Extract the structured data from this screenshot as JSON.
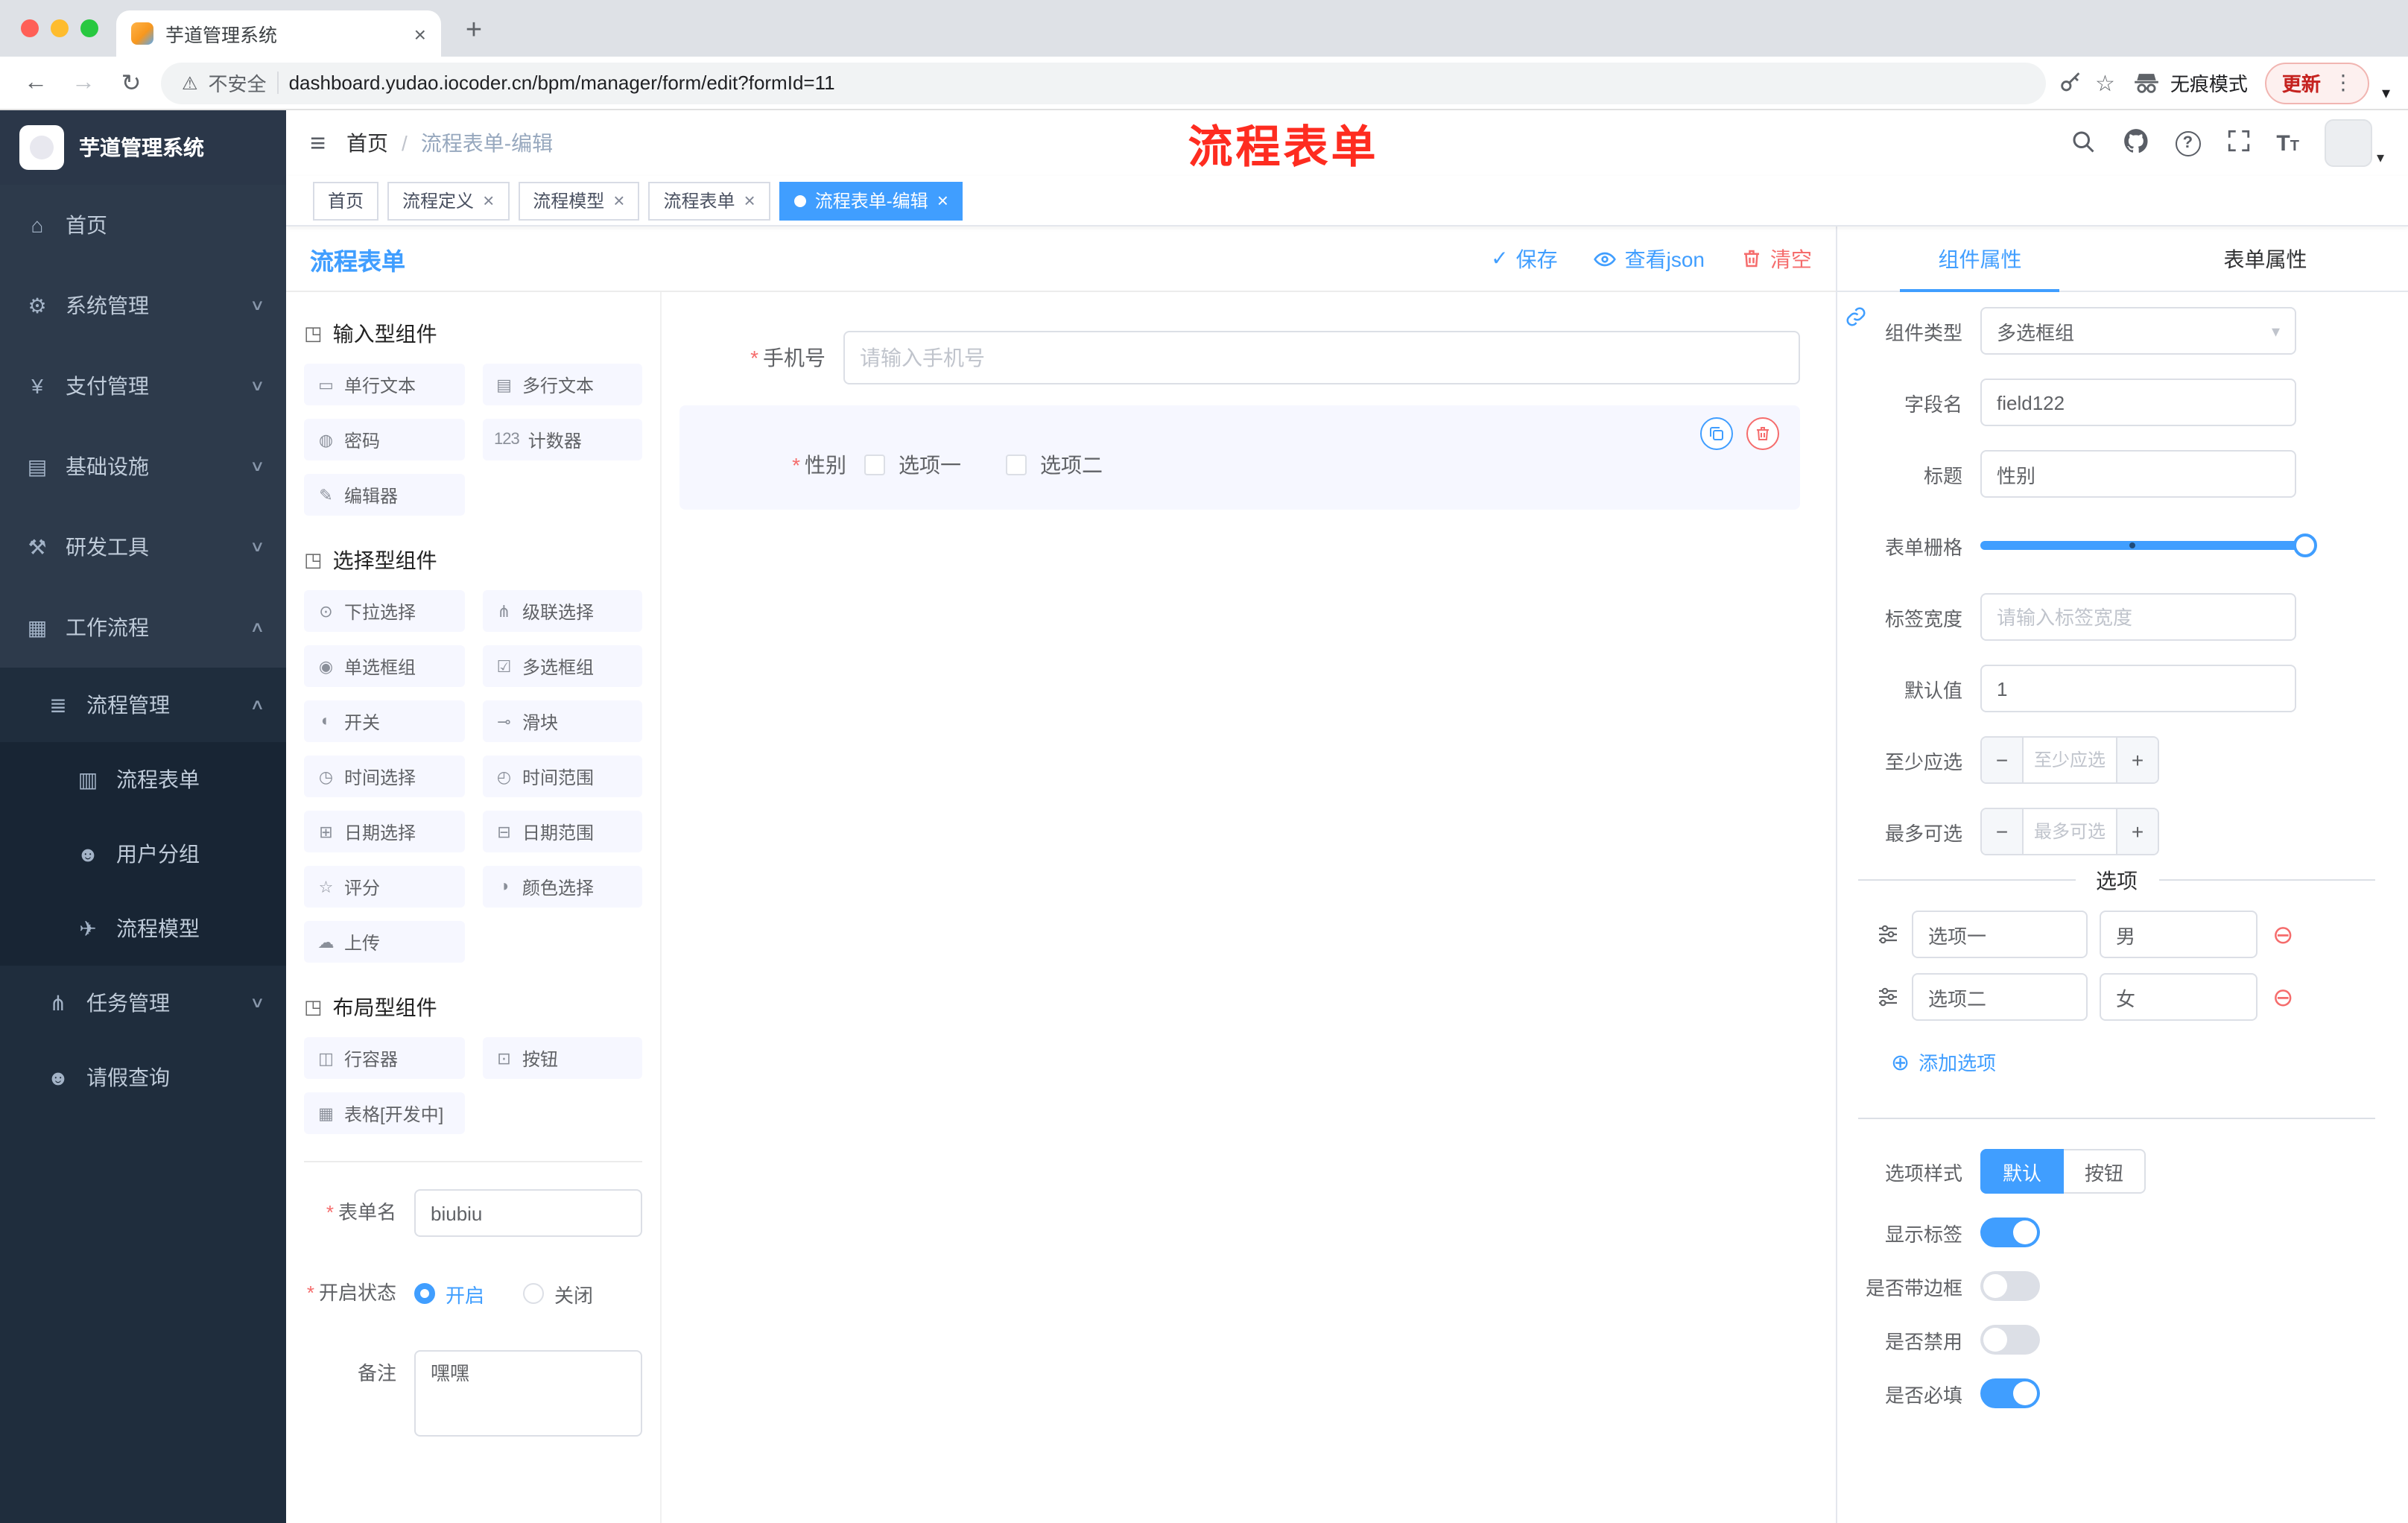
{
  "colors": {
    "primary": "#409eff",
    "danger": "#f56c6c",
    "sidebar_bg": "#2d3a4b",
    "annotation_red": "#fe2c20",
    "tag_active": "#409eff"
  },
  "icons": {
    "back": "←",
    "forward": "→",
    "reload": "↻",
    "warning": "⚠",
    "star": "☆",
    "kebab": "⋮",
    "caret_down": "▾",
    "plus": "+",
    "close": "×",
    "hamburger": "≡",
    "check": "✓",
    "circle_plus": "⊕",
    "circle_minus": "⊖",
    "minus": "−",
    "chevron_down": "∨",
    "chevron_up": "∧",
    "select_caret": "▾",
    "required": "*"
  },
  "browser": {
    "tab_title": "芋道管理系统",
    "security_label": "不安全",
    "url": "dashboard.yudao.iocoder.cn/bpm/manager/form/edit?formId=11",
    "incognito_label": "无痕模式",
    "update_label": "更新"
  },
  "sidebar": {
    "app_title": "芋道管理系统",
    "items": [
      {
        "icon": "⌂",
        "label": "首页"
      },
      {
        "icon": "⚙",
        "label": "系统管理"
      },
      {
        "icon": "¥",
        "label": "支付管理"
      },
      {
        "icon": "▤",
        "label": "基础设施"
      },
      {
        "icon": "⚒",
        "label": "研发工具"
      },
      {
        "icon": "▦",
        "label": "工作流程"
      },
      {
        "icon": "≣",
        "label": "流程管理"
      },
      {
        "icon": "▥",
        "label": "流程表单"
      },
      {
        "icon": "☻",
        "label": "用户分组"
      },
      {
        "icon": "✈",
        "label": "流程模型"
      },
      {
        "icon": "⋔",
        "label": "任务管理"
      },
      {
        "icon": "☻",
        "label": "请假查询"
      }
    ]
  },
  "navbar": {
    "breadcrumb_home": "首页",
    "breadcrumb_sep": "/",
    "breadcrumb_current": "流程表单-编辑",
    "annotation": "流程表单"
  },
  "tags": [
    {
      "label": "首页"
    },
    {
      "label": "流程定义",
      "close": "×"
    },
    {
      "label": "流程模型",
      "close": "×"
    },
    {
      "label": "流程表单",
      "close": "×"
    },
    {
      "label": "流程表单-编辑",
      "close": "×"
    }
  ],
  "designer": {
    "title": "流程表单",
    "save": "保存",
    "view_json": "查看json",
    "clear": "清空"
  },
  "palette": {
    "sections": [
      {
        "icon": "◳",
        "title": "输入型组件",
        "items": [
          {
            "icon": "▭",
            "label": "单行文本"
          },
          {
            "icon": "▤",
            "label": "多行文本"
          },
          {
            "icon": "◍",
            "label": "密码"
          },
          {
            "icon": "123",
            "label": "计数器"
          },
          {
            "icon": "✎",
            "label": "编辑器"
          }
        ]
      },
      {
        "icon": "◳",
        "title": "选择型组件",
        "items": [
          {
            "icon": "⊙",
            "label": "下拉选择"
          },
          {
            "icon": "⋔",
            "label": "级联选择"
          },
          {
            "icon": "◉",
            "label": "单选框组"
          },
          {
            "icon": "☑",
            "label": "多选框组"
          },
          {
            "icon": "◐",
            "label": "开关"
          },
          {
            "icon": "⊸",
            "label": "滑块"
          },
          {
            "icon": "◷",
            "label": "时间选择"
          },
          {
            "icon": "◴",
            "label": "时间范围"
          },
          {
            "icon": "⊞",
            "label": "日期选择"
          },
          {
            "icon": "⊟",
            "label": "日期范围"
          },
          {
            "icon": "☆",
            "label": "评分"
          },
          {
            "icon": "◑",
            "label": "颜色选择"
          },
          {
            "icon": "☁",
            "label": "上传"
          }
        ]
      },
      {
        "icon": "◳",
        "title": "布局型组件",
        "items": [
          {
            "icon": "◫",
            "label": "行容器"
          },
          {
            "icon": "⊡",
            "label": "按钮"
          },
          {
            "icon": "▦",
            "label": "表格[开发中]"
          }
        ]
      }
    ],
    "form": {
      "name_label": "表单名",
      "name_value": "biubiu",
      "status_label": "开启状态",
      "status_on": "开启",
      "status_off": "关闭",
      "remark_label": "备注",
      "remark_value": "嘿嘿"
    }
  },
  "canvas": {
    "phone_label": "手机号",
    "phone_placeholder": "请输入手机号",
    "gender_label": "性别",
    "gender_option1": "选项一",
    "gender_option2": "选项二"
  },
  "props": {
    "tab_component": "组件属性",
    "tab_form": "表单属性",
    "rows": {
      "type_label": "组件类型",
      "type_value": "多选框组",
      "field_label": "字段名",
      "field_value": "field122",
      "title_label": "标题",
      "title_value": "性别",
      "grid_label": "表单栅格",
      "width_label": "标签宽度",
      "width_placeholder": "请输入标签宽度",
      "default_label": "默认值",
      "default_value": "1",
      "min_label": "至少应选",
      "min_placeholder": "至少应选",
      "max_label": "最多可选",
      "max_placeholder": "最多可选"
    },
    "options_title": "选项",
    "options": [
      {
        "label": "选项一",
        "value": "男"
      },
      {
        "label": "选项二",
        "value": "女"
      }
    ],
    "add_option": "添加选项",
    "style_label": "选项样式",
    "style_default": "默认",
    "style_button": "按钮",
    "switch_rows": [
      {
        "label": "显示标签",
        "on": true
      },
      {
        "label": "是否带边框",
        "on": false
      },
      {
        "label": "是否禁用",
        "on": false
      },
      {
        "label": "是否必填",
        "on": true
      }
    ]
  }
}
